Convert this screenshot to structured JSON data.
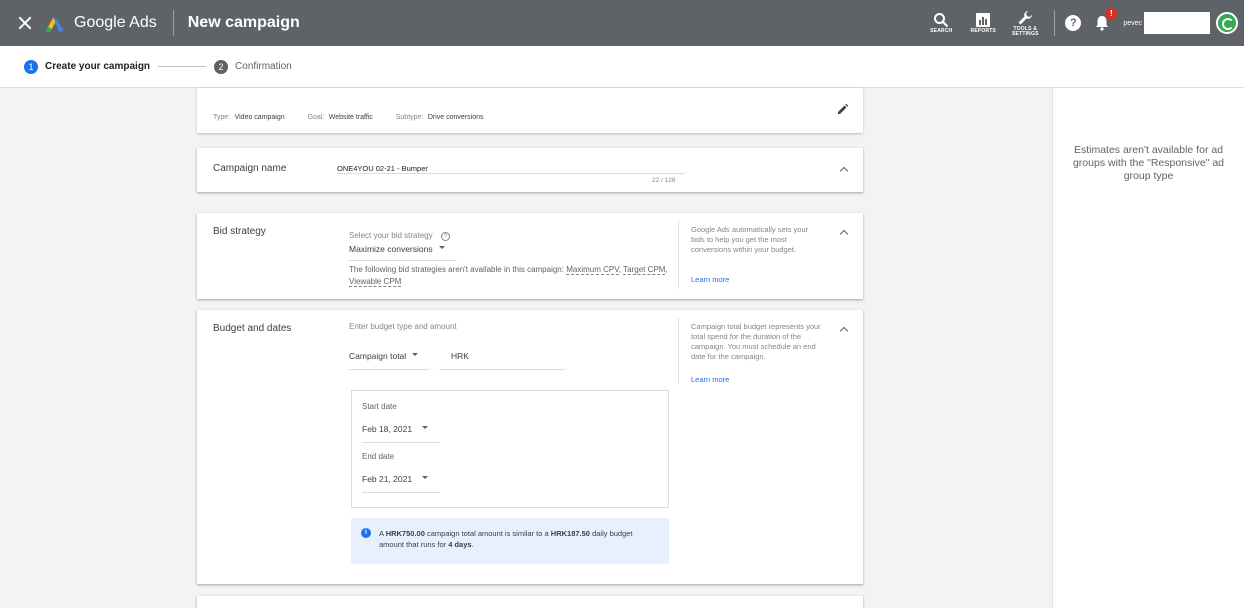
{
  "header": {
    "brand": "Google Ads",
    "title": "New campaign",
    "tools": [
      {
        "label": "SEARCH",
        "icon": "search-icon"
      },
      {
        "label": "REPORTS",
        "icon": "reports-icon"
      },
      {
        "label": "TOOLS & SETTINGS",
        "icon": "wrench-icon"
      }
    ],
    "help": "?",
    "notification_badge": "!",
    "account": "pevec"
  },
  "stepper": {
    "steps": [
      {
        "number": "1",
        "label": "Create your campaign"
      },
      {
        "number": "2",
        "label": "Confirmation"
      }
    ]
  },
  "summary": {
    "type_label": "Type:",
    "type_value": "Video campaign",
    "goal_label": "Goal:",
    "goal_value": "Website traffic",
    "subtype_label": "Subtype:",
    "subtype_value": "Drive conversions"
  },
  "campaign_name": {
    "label": "Campaign name",
    "value": "ONE4YOU 02-21 - Bumper",
    "counter": "22 / 128"
  },
  "bid_strategy": {
    "label": "Bid strategy",
    "prompt": "Select your bid strategy",
    "help_icon": "?",
    "selected": "Maximize conversions",
    "note_prefix": "The following bid strategies aren't available in this campaign:",
    "unavailable": [
      "Maximum CPV",
      "Target CPM",
      "Viewable CPM"
    ],
    "help_text": "Google Ads automatically sets your bids to help you get the most conversions within your budget.",
    "learn_more": "Learn more"
  },
  "budget": {
    "label": "Budget and dates",
    "prompt": "Enter budget type and amount",
    "type_selected": "Campaign total",
    "currency": "HRK",
    "help_text": "Campaign total budget represents your total spend for the duration of the campaign. You must schedule an end date for the campaign.",
    "learn_more": "Learn more",
    "start_label": "Start date",
    "start_value": "Feb 18, 2021",
    "end_label": "End date",
    "end_value": "Feb 21, 2021",
    "info": {
      "icon": "i",
      "p1": "A ",
      "total": "HRK750.00",
      "p2": " campaign total amount is similar to a ",
      "daily": "HRK187.50",
      "p3": " daily budget amount that runs for ",
      "days": "4 days",
      "p4": "."
    }
  },
  "sidebar": {
    "estimates_note": "Estimates aren't available for ad groups with the \"Responsive\" ad group type"
  },
  "colors": {
    "topbar": "#5f6368",
    "primary": "#1a73e8",
    "step_inactive": "#5f6368",
    "info_bg": "#e8f0fe",
    "background": "#f1f3f4"
  }
}
